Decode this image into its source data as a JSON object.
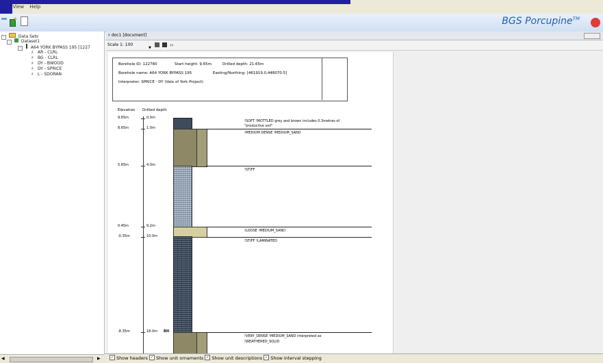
{
  "menu": [
    "ile",
    "View",
    "Help"
  ],
  "brand": {
    "name": "BGS Porcupine",
    "mark": "TM"
  },
  "tree": {
    "root": "Data Sets",
    "dataset": "Dataset1",
    "borehole": "A64 YORK BYPASS 195 [1227",
    "interpretations": [
      "AR - CLRL",
      "BG - CLRL",
      "DY - BWOOD",
      "DY - SPRICE",
      "L - SDORAN"
    ]
  },
  "doc": {
    "tab": "doc1 [document]",
    "scale": "Scale 1: 100"
  },
  "header": {
    "borehole_id": "Borehole ID: 122780",
    "start_height": "Start height: 9.65m",
    "drilled_depth": "Drilled depth: 21.65m",
    "borehole_name": "Borehole name: A64 YORK BYPASS 195",
    "easting_northing": "Easting/Northing: [461919.0,448070.5]",
    "interpreter": "Interpreter: SPRICE - DY (Vale of York Project)"
  },
  "log": {
    "col_elev": "Elevation",
    "col_depth": "Drilled depth",
    "elevations": [
      "9.65m",
      "8.65m",
      "5.65m",
      "0.45m",
      "-0.35m",
      "-8.35m"
    ],
    "depths": [
      "0.0m",
      "1.0m",
      "4.0m",
      "9.2m",
      "10.0m",
      "18.0m"
    ],
    "rh": "RH",
    "descriptions": [
      "!SOFT !MOTTLED grey and brown includes 0.3metres of",
      "\"productive soil\"",
      "!MEDIUM DENSE !MEDIUM_SAND",
      "!STIFF",
      "!LOOSE !MEDIUM_SAND",
      "!STIFF !LAMINATED",
      "!VERY_DENSE !MEDIUM_SAND interpreted as",
      "!WEATHERED_SOLID"
    ]
  },
  "status": {
    "show_headers": "Show headers",
    "show_ornaments": "Show unit ornaments",
    "show_descriptions": "Show unit descriptions",
    "show_stepping": "Show interval stepping"
  }
}
